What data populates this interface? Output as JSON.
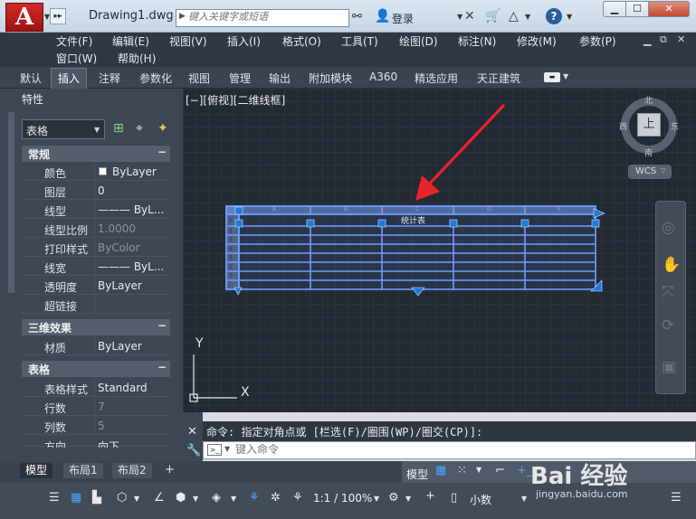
{
  "title_bar": {
    "app_logo": "A",
    "document_title": "Drawing1.dwg",
    "search_placeholder": "键入关键字或短语",
    "login_label": "登录",
    "help_label": "?"
  },
  "menu": {
    "row1": [
      "文件(F)",
      "编辑(E)",
      "视图(V)",
      "插入(I)",
      "格式(O)",
      "工具(T)",
      "绘图(D)",
      "标注(N)",
      "修改(M)",
      "参数(P)"
    ],
    "row2": [
      "窗口(W)",
      "帮助(H)"
    ]
  },
  "ribbon_tabs": [
    "默认",
    "插入",
    "注释",
    "参数化",
    "视图",
    "管理",
    "输出",
    "附加模块",
    "A360",
    "精选应用",
    "天正建筑"
  ],
  "ribbon_active_tab": "插入",
  "properties": {
    "title": "特性",
    "object_type": "表格",
    "sections": {
      "general": {
        "header": "常规",
        "toggle": "−",
        "rows": [
          {
            "label": "颜色",
            "value": "ByLayer"
          },
          {
            "label": "图层",
            "value": "0"
          },
          {
            "label": "线型",
            "value": "——— ByL..."
          },
          {
            "label": "线型比例",
            "value": "1.0000"
          },
          {
            "label": "打印样式",
            "value": "ByColor"
          },
          {
            "label": "线宽",
            "value": "——— ByL..."
          },
          {
            "label": "透明度",
            "value": "ByLayer"
          },
          {
            "label": "超链接",
            "value": ""
          }
        ]
      },
      "3d": {
        "header": "三维效果",
        "toggle": "−",
        "rows": [
          {
            "label": "材质",
            "value": "ByLayer"
          }
        ]
      },
      "table": {
        "header": "表格",
        "toggle": "−",
        "rows": [
          {
            "label": "表格样式",
            "value": "Standard"
          },
          {
            "label": "行数",
            "value": "7"
          },
          {
            "label": "列数",
            "value": "5"
          },
          {
            "label": "方向",
            "value": "向下"
          }
        ]
      }
    }
  },
  "viewport": {
    "label": "[−][俯视][二维线框]",
    "viewcube": {
      "face": "上",
      "north": "北",
      "south": "南",
      "east": "东",
      "west": "西"
    },
    "wcs_label": "WCS",
    "table_title": "统计表",
    "column_letters": [
      "A",
      "B",
      "C",
      "D",
      "E"
    ],
    "row_numbers": [
      "1",
      "2",
      "3",
      "4",
      "5",
      "6",
      "7"
    ],
    "ucs_y": "Y",
    "ucs_x": "X"
  },
  "command": {
    "history": "命令: 指定对角点或 [栏选(F)/圈围(WP)/圈交(CP)]:",
    "input_placeholder": "键入命令"
  },
  "layout_tabs": [
    "模型",
    "布局1",
    "布局2"
  ],
  "status": {
    "model_label": "模型",
    "scale": "1:1 / 100%",
    "units": "小数"
  },
  "watermark": {
    "text": "Bai 经验",
    "url": "jingyan.baidu.com"
  },
  "colors": {
    "table_highlight": "#4f8dff",
    "grip_blue": "#1f7ae0",
    "arrow_red": "#e8242a"
  }
}
